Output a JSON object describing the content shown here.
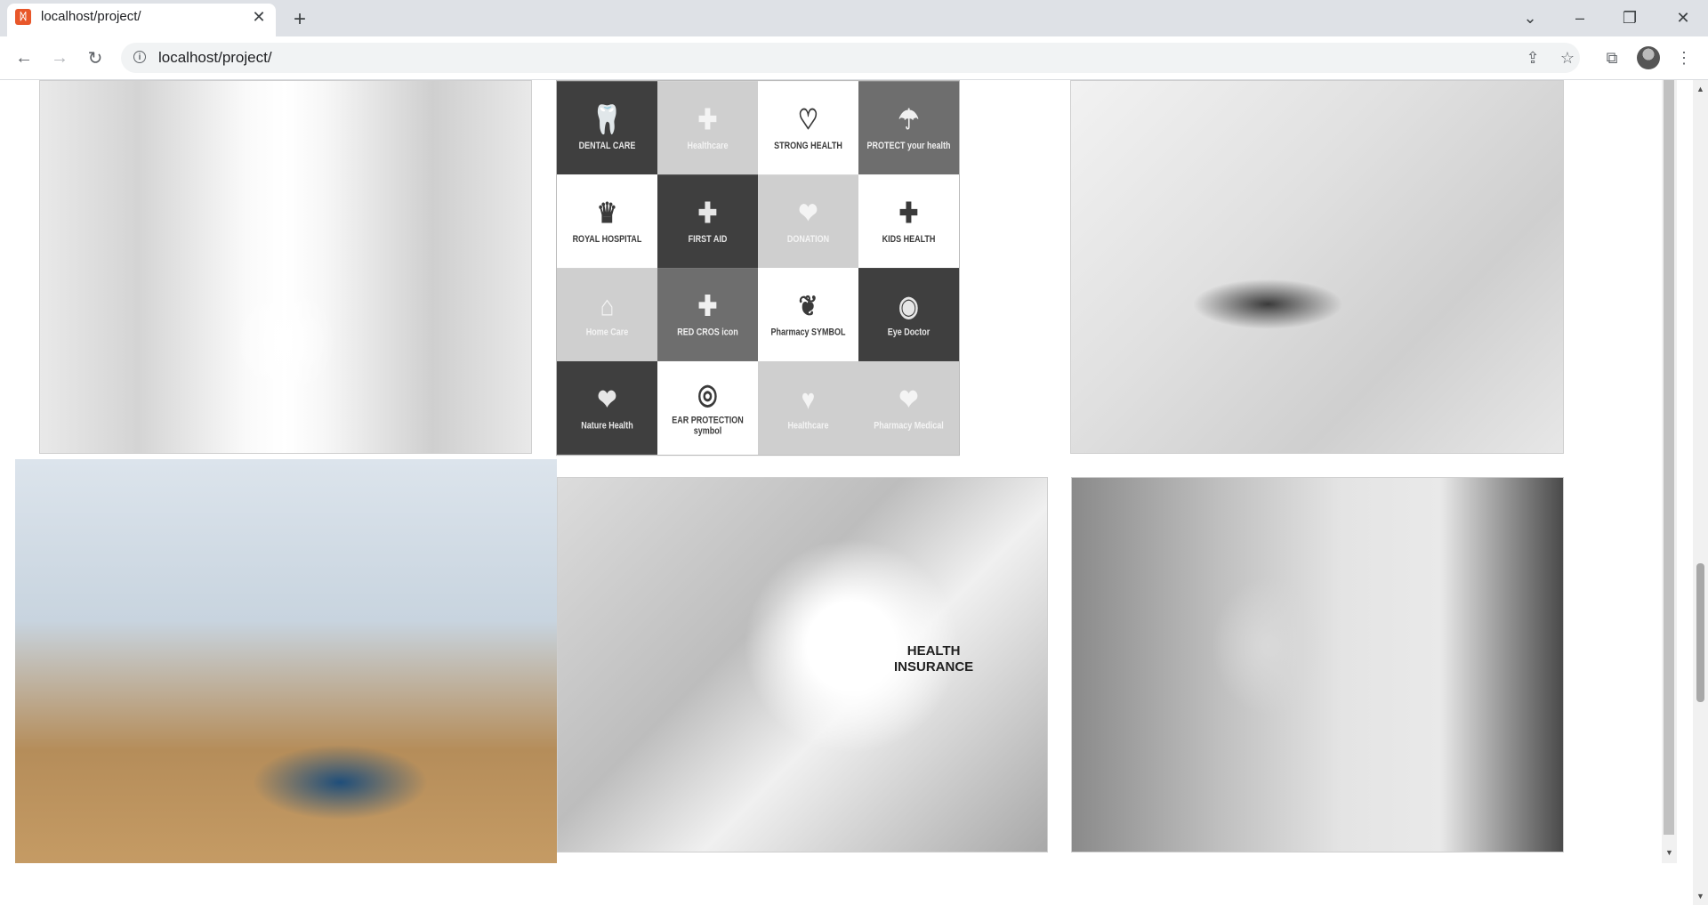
{
  "browser": {
    "tab_title": "localhost/project/",
    "url": "localhost/project/",
    "icons": {
      "favicon": "xampp-favicon-icon",
      "close": "close-icon",
      "new_tab": "plus-icon",
      "back": "back-arrow-icon",
      "forward": "forward-arrow-icon",
      "reload": "reload-icon",
      "info": "info-icon",
      "share": "share-icon",
      "bookmark": "star-icon",
      "extensions": "puzzle-icon",
      "menu": "kebab-menu-icon"
    }
  },
  "gallery": {
    "icon_tiles": [
      {
        "label": "DENTAL CARE",
        "glyph": "🦷",
        "tone": "dark"
      },
      {
        "label": "Healthcare",
        "glyph": "✚",
        "tone": "light"
      },
      {
        "label": "STRONG HEALTH",
        "glyph": "♡",
        "tone": "white"
      },
      {
        "label": "PROTECT your health",
        "glyph": "☂",
        "tone": "mid"
      },
      {
        "label": "ROYAL HOSPITAL",
        "glyph": "♛",
        "tone": "white"
      },
      {
        "label": "FIRST AID",
        "glyph": "✚",
        "tone": "dark"
      },
      {
        "label": "DONATION",
        "glyph": "❤",
        "tone": "light"
      },
      {
        "label": "KIDS HEALTH",
        "glyph": "✚",
        "tone": "white"
      },
      {
        "label": "Home Care",
        "glyph": "⌂",
        "tone": "light"
      },
      {
        "label": "RED CROS icon",
        "glyph": "✚",
        "tone": "mid"
      },
      {
        "label": "Pharmacy SYMBOL",
        "glyph": "❦",
        "tone": "white"
      },
      {
        "label": "Eye Doctor",
        "glyph": "◉",
        "tone": "dark"
      },
      {
        "label": "Nature Health",
        "glyph": "❤",
        "tone": "dark"
      },
      {
        "label": "EAR PROTECTION symbol",
        "glyph": "◎",
        "tone": "white"
      },
      {
        "label": "Healthcare",
        "glyph": "♥",
        "tone": "light"
      },
      {
        "label": "Pharmacy Medical",
        "glyph": "❤",
        "tone": "light"
      }
    ],
    "health_insurance_text": "HEALTH\nINSURANCE"
  }
}
